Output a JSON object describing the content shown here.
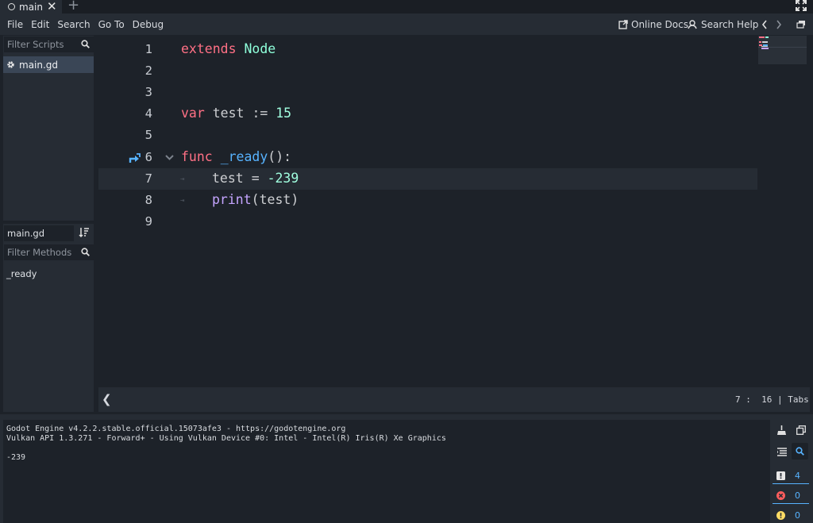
{
  "scene_tabs": {
    "active": "main",
    "add_label": "+"
  },
  "menu": {
    "items": [
      "File",
      "Edit",
      "Search",
      "Go To",
      "Debug"
    ]
  },
  "toolbar": {
    "online_docs": "Online Docs",
    "search_help": "Search Help"
  },
  "scripts_panel": {
    "filter_placeholder": "Filter Scripts",
    "items": [
      {
        "label": "main.gd",
        "selected": true
      }
    ]
  },
  "methods_panel": {
    "script_name": "main.gd",
    "filter_placeholder": "Filter Methods",
    "items": [
      "_ready"
    ]
  },
  "editor": {
    "line_numbers": [
      "1",
      "2",
      "3",
      "4",
      "5",
      "6",
      "7",
      "8",
      "9"
    ],
    "current_line": 7,
    "code": {
      "l1_kw": "extends",
      "l1_cls": "Node",
      "l4_kw": "var",
      "l4_name": "test",
      "l4_op": ":=",
      "l4_num": "15",
      "l6_kw": "func",
      "l6_fn": "_ready",
      "l6_rest": "():",
      "l7_name": "test",
      "l7_op": "=",
      "l7_num": "-239",
      "l8_fn": "print",
      "l8_rest": "(test)"
    }
  },
  "status": {
    "line": "7",
    "sep": ":",
    "col": "16",
    "divider": "|",
    "indent": "Tabs"
  },
  "output": {
    "lines": [
      "Godot Engine v4.2.2.stable.official.15073afe3 - https://godotengine.org",
      "Vulkan API 1.3.271 - Forward+ - Using Vulkan Device #0: Intel - Intel(R) Iris(R) Xe Graphics",
      "",
      "-239"
    ],
    "counts": {
      "messages": "4",
      "errors": "0",
      "warnings": "0"
    }
  },
  "colors": {
    "keyword": "#ff7085",
    "class": "#8effda",
    "number": "#a1ffe0",
    "function": "#57b3ff",
    "builtin": "#c5a5ff",
    "accent": "#57b3ff"
  }
}
